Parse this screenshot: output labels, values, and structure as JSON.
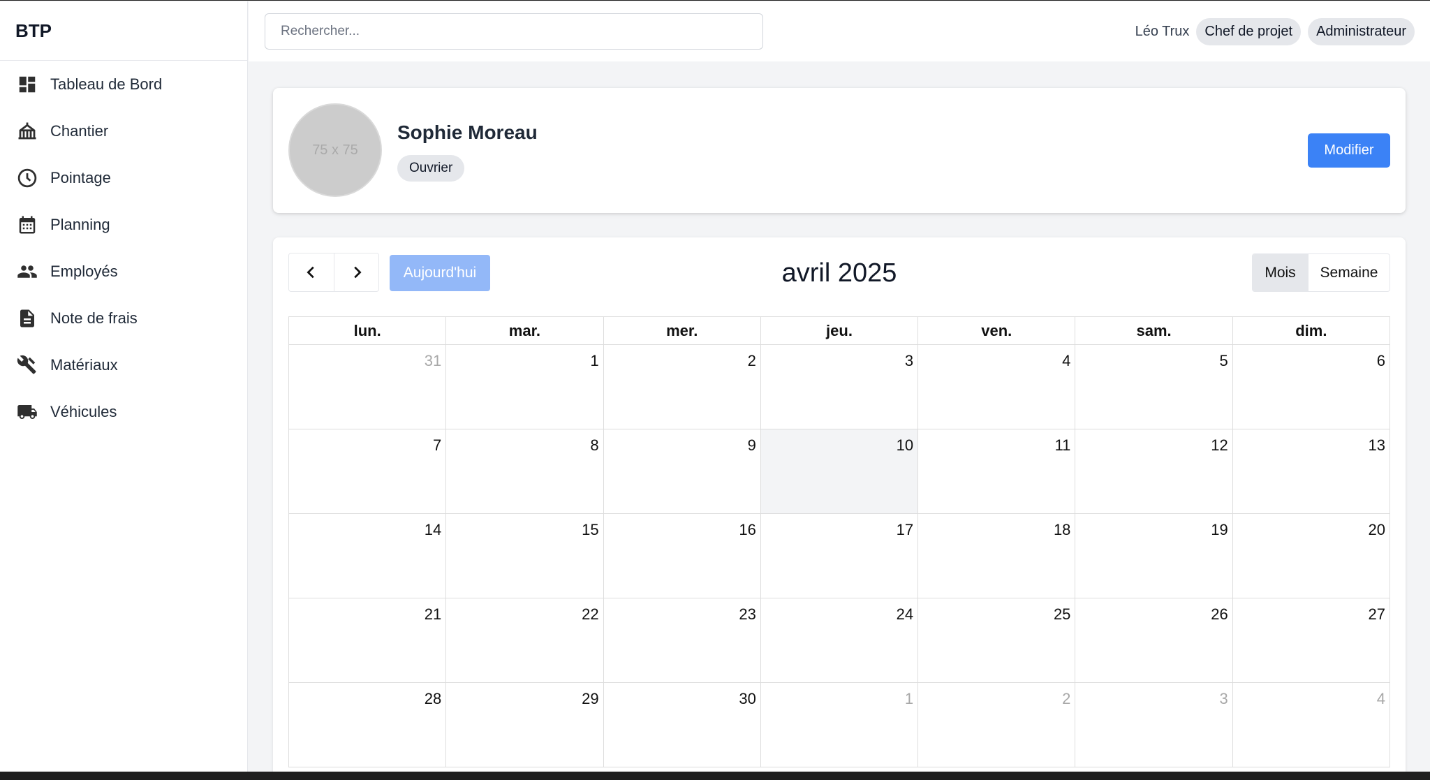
{
  "app": {
    "brand": "BTP"
  },
  "sidebar": {
    "items": [
      {
        "label": "Tableau de Bord",
        "icon": "dashboard-icon"
      },
      {
        "label": "Chantier",
        "icon": "construction-site-icon"
      },
      {
        "label": "Pointage",
        "icon": "clock-icon"
      },
      {
        "label": "Planning",
        "icon": "calendar-icon"
      },
      {
        "label": "Employés",
        "icon": "people-icon"
      },
      {
        "label": "Note de frais",
        "icon": "document-icon"
      },
      {
        "label": "Matériaux",
        "icon": "tools-icon"
      },
      {
        "label": "Véhicules",
        "icon": "truck-icon"
      }
    ]
  },
  "header": {
    "search_placeholder": "Rechercher...",
    "user_name": "Léo Trux",
    "roles": [
      "Chef de projet",
      "Administrateur"
    ]
  },
  "profile": {
    "avatar_placeholder": "75 x 75",
    "name": "Sophie Moreau",
    "role": "Ouvrier",
    "edit_label": "Modifier"
  },
  "calendar": {
    "title": "avril 2025",
    "today_label": "Aujourd'hui",
    "view_month": "Mois",
    "view_week": "Semaine",
    "weekdays": [
      "lun.",
      "mar.",
      "mer.",
      "jeu.",
      "ven.",
      "sam.",
      "dim."
    ],
    "days": [
      {
        "d": "31",
        "other": true
      },
      {
        "d": "1"
      },
      {
        "d": "2"
      },
      {
        "d": "3"
      },
      {
        "d": "4"
      },
      {
        "d": "5"
      },
      {
        "d": "6"
      },
      {
        "d": "7"
      },
      {
        "d": "8"
      },
      {
        "d": "9"
      },
      {
        "d": "10",
        "today": true
      },
      {
        "d": "11"
      },
      {
        "d": "12"
      },
      {
        "d": "13"
      },
      {
        "d": "14"
      },
      {
        "d": "15"
      },
      {
        "d": "16"
      },
      {
        "d": "17"
      },
      {
        "d": "18"
      },
      {
        "d": "19"
      },
      {
        "d": "20"
      },
      {
        "d": "21"
      },
      {
        "d": "22"
      },
      {
        "d": "23"
      },
      {
        "d": "24"
      },
      {
        "d": "25"
      },
      {
        "d": "26"
      },
      {
        "d": "27"
      },
      {
        "d": "28"
      },
      {
        "d": "29"
      },
      {
        "d": "30"
      },
      {
        "d": "1",
        "other": true
      },
      {
        "d": "2",
        "other": true
      },
      {
        "d": "3",
        "other": true
      },
      {
        "d": "4",
        "other": true
      }
    ]
  },
  "colors": {
    "accent": "#3b82f6",
    "today_button": "#93b8f8",
    "pill_bg": "#e5e7eb"
  }
}
